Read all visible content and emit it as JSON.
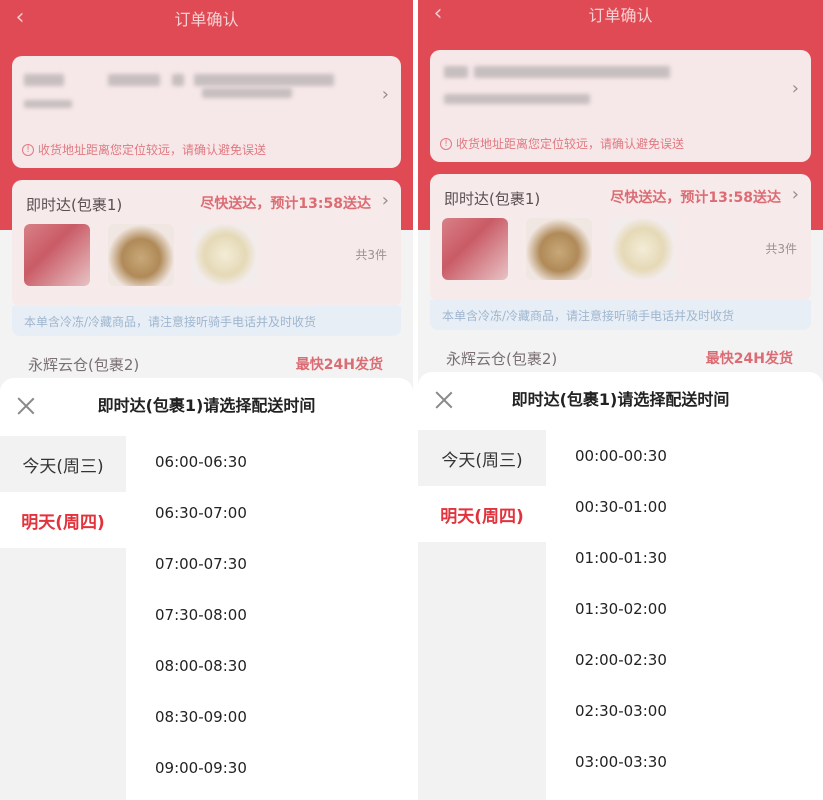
{
  "page_title": "订单确认",
  "address_warning": "收货地址距离您定位较远，请确认避免误送",
  "package1": {
    "name": "即时达(包裹1)",
    "eta": "尽快送达，预计13:58送达",
    "count": "共3件",
    "cold_notice": "本单含冷冻/冷藏商品，请注意接听骑手电话并及时收货"
  },
  "package2": {
    "name": "永辉云仓(包裹2)",
    "eta": "最快24H发货"
  },
  "sheet": {
    "title": "即时达(包裹1)请选择配送时间"
  },
  "days": [
    "今天(周三)",
    "明天(周四)"
  ],
  "selected_day": "明天(周四)",
  "left_slots": [
    "06:00-06:30",
    "06:30-07:00",
    "07:00-07:30",
    "07:30-08:00",
    "08:00-08:30",
    "08:30-09:00",
    "09:00-09:30"
  ],
  "right_slots": [
    "00:00-00:30",
    "00:30-01:00",
    "01:00-01:30",
    "01:30-02:00",
    "02:00-02:30",
    "02:30-03:00",
    "03:00-03:30"
  ],
  "icons": {
    "back": "chevron-left-icon",
    "close": "close-icon",
    "warning": "info-circle-icon",
    "chevron": "chevron-right-icon"
  },
  "colors": {
    "header_red": "#e04a55",
    "accent_red": "#e2333d",
    "sidebar_gray": "#f2f2f2"
  }
}
